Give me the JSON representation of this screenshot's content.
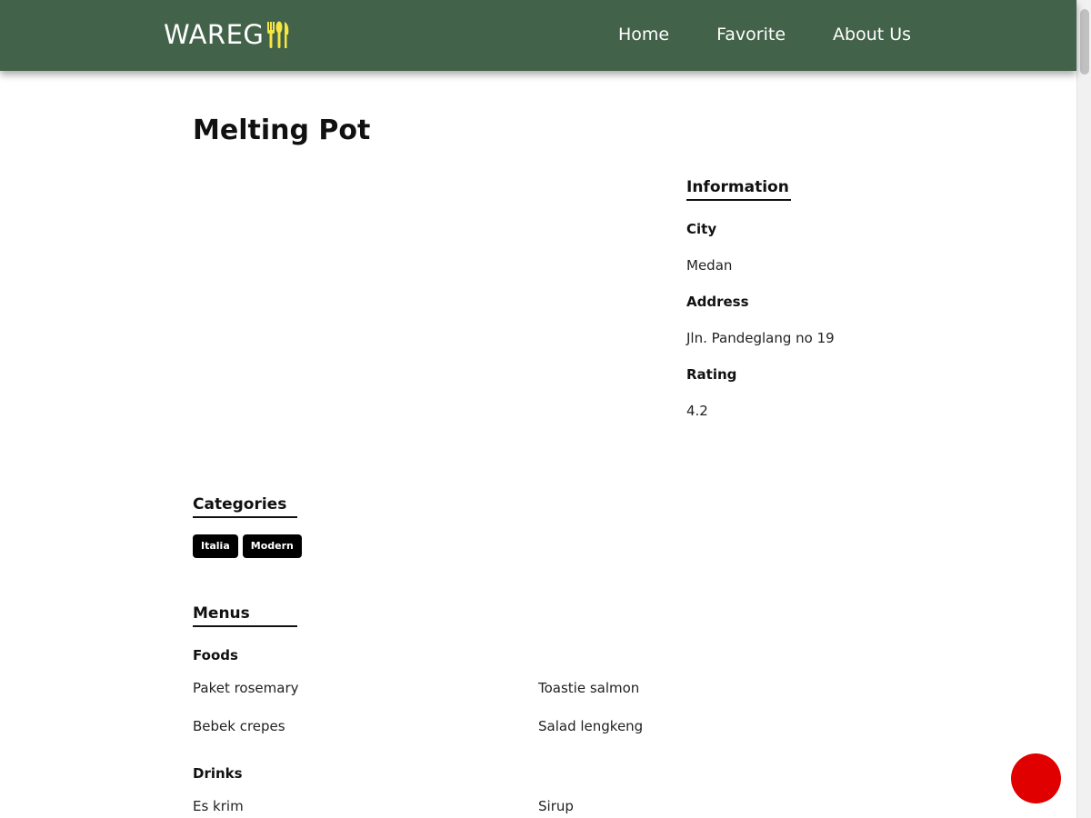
{
  "navbar": {
    "brand_text": "WAREG",
    "brand_icon": "utensils-icon",
    "links": [
      "Home",
      "Favorite",
      "About Us"
    ]
  },
  "restaurant": {
    "name": "Melting Pot",
    "information": {
      "heading": "Information",
      "city_label": "City",
      "city": "Medan",
      "address_label": "Address",
      "address": "Jln. Pandeglang no 19",
      "rating_label": "Rating",
      "rating": "4.2"
    },
    "categories": {
      "heading": "Categories",
      "items": [
        "Italia",
        "Modern"
      ]
    },
    "menus": {
      "heading": "Menus",
      "foods_label": "Foods",
      "foods": [
        "Paket rosemary",
        "Toastie salmon",
        "Bebek crepes",
        "Salad lengkeng"
      ],
      "drinks_label": "Drinks",
      "drinks": [
        "Es krim",
        "Sirup"
      ]
    }
  },
  "colors": {
    "navbar": "#43624a",
    "brand_accent": "#f5e642",
    "fab": "#e00000"
  }
}
